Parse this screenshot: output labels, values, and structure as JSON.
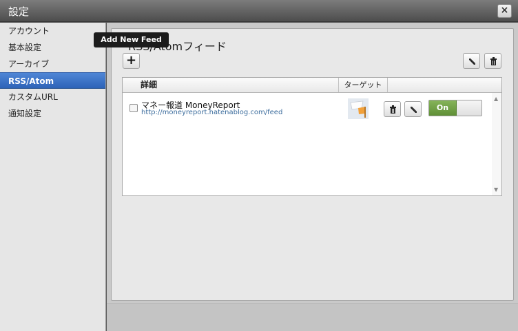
{
  "window": {
    "title": "設定",
    "close_label": "×"
  },
  "sidebar": {
    "items": [
      {
        "label": "アカウント"
      },
      {
        "label": "基本設定"
      },
      {
        "label": "アーカイブ"
      },
      {
        "label": "RSS/Atom",
        "active": true
      },
      {
        "label": "カスタムURL"
      },
      {
        "label": "通知設定"
      }
    ]
  },
  "section": {
    "title": "RSS/Atomフィード"
  },
  "toolbar": {
    "add_label": "+",
    "tooltip": "Add New Feed"
  },
  "table": {
    "columns": [
      "詳細",
      "ターゲット"
    ],
    "rows": [
      {
        "name": "マネー報道 MoneyReport",
        "url": "http://moneyreport.hatenablog.com/feed",
        "toggle": "On"
      }
    ]
  },
  "colors": {
    "accent": "#2d63b8",
    "toggle_on": "#6a9a3e",
    "link": "#3a6b9c"
  }
}
